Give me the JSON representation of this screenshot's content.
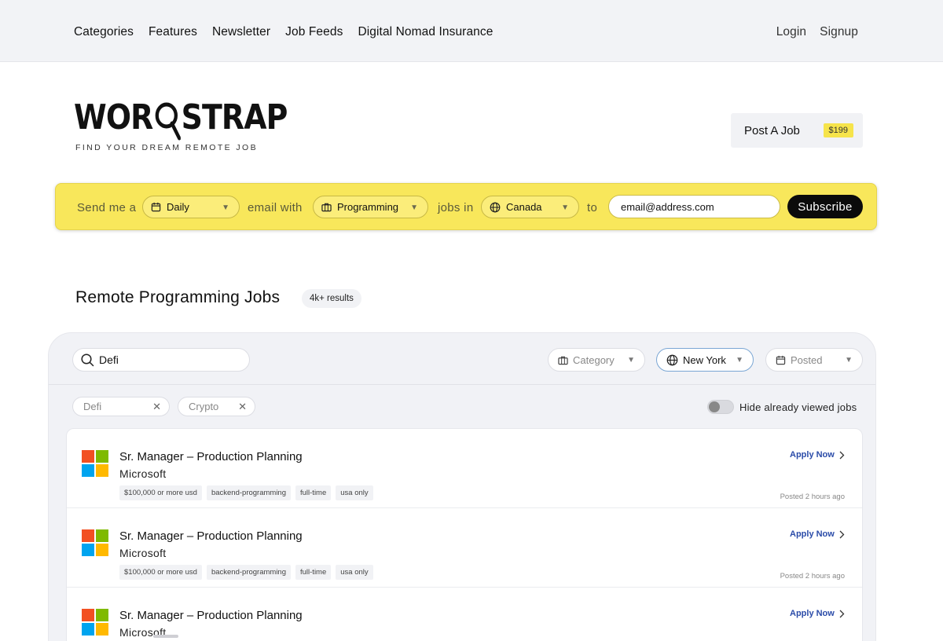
{
  "nav": {
    "items": [
      "Categories",
      "Features",
      "Newsletter",
      "Job Feeds",
      "Digital Nomad Insurance"
    ],
    "login": "Login",
    "signup": "Signup"
  },
  "brand": {
    "logo_left": "WOR",
    "logo_right": "STRAP",
    "tagline": "FIND YOUR DREAM REMOTE JOB"
  },
  "post_job": {
    "label": "Post A Job",
    "price": "$199"
  },
  "subscribe": {
    "text_send": "Send me a",
    "frequency": "Daily",
    "text_email": "email with",
    "category": "Programming",
    "text_jobs_in": "jobs in",
    "location": "Canada",
    "text_to": "to",
    "email_value": "email@address.com",
    "button": "Subscribe"
  },
  "section": {
    "title": "Remote Programming Jobs",
    "results": "4k+ results"
  },
  "filters": {
    "search_value": "Defi",
    "category_placeholder": "Category",
    "location": "New York",
    "posted_placeholder": "Posted",
    "chips": [
      "Defi",
      "Crypto"
    ],
    "toggle_label": "Hide already viewed jobs"
  },
  "jobs": [
    {
      "title": "Sr. Manager – Production Planning",
      "company": "Microsoft",
      "tags": [
        "$100,000 or more usd",
        "backend-programming",
        "full-time",
        "usa only"
      ],
      "apply": "Apply Now",
      "posted": "Posted 2 hours ago"
    },
    {
      "title": "Sr. Manager – Production Planning",
      "company": "Microsoft",
      "tags": [
        "$100,000 or more usd",
        "backend-programming",
        "full-time",
        "usa only"
      ],
      "apply": "Apply Now",
      "posted": "Posted 2 hours ago"
    },
    {
      "title": "Sr. Manager – Production Planning",
      "company": "Microsoft",
      "tags": [],
      "apply": "Apply Now",
      "posted": ""
    }
  ],
  "colors": {
    "subscribe_bar": "#f8e75b",
    "price_badge": "#f6e44b",
    "apply_link": "#2a4ba8",
    "ms_red": "#f25022",
    "ms_green": "#7fba00",
    "ms_blue": "#00a4ef",
    "ms_yellow": "#ffb900"
  }
}
